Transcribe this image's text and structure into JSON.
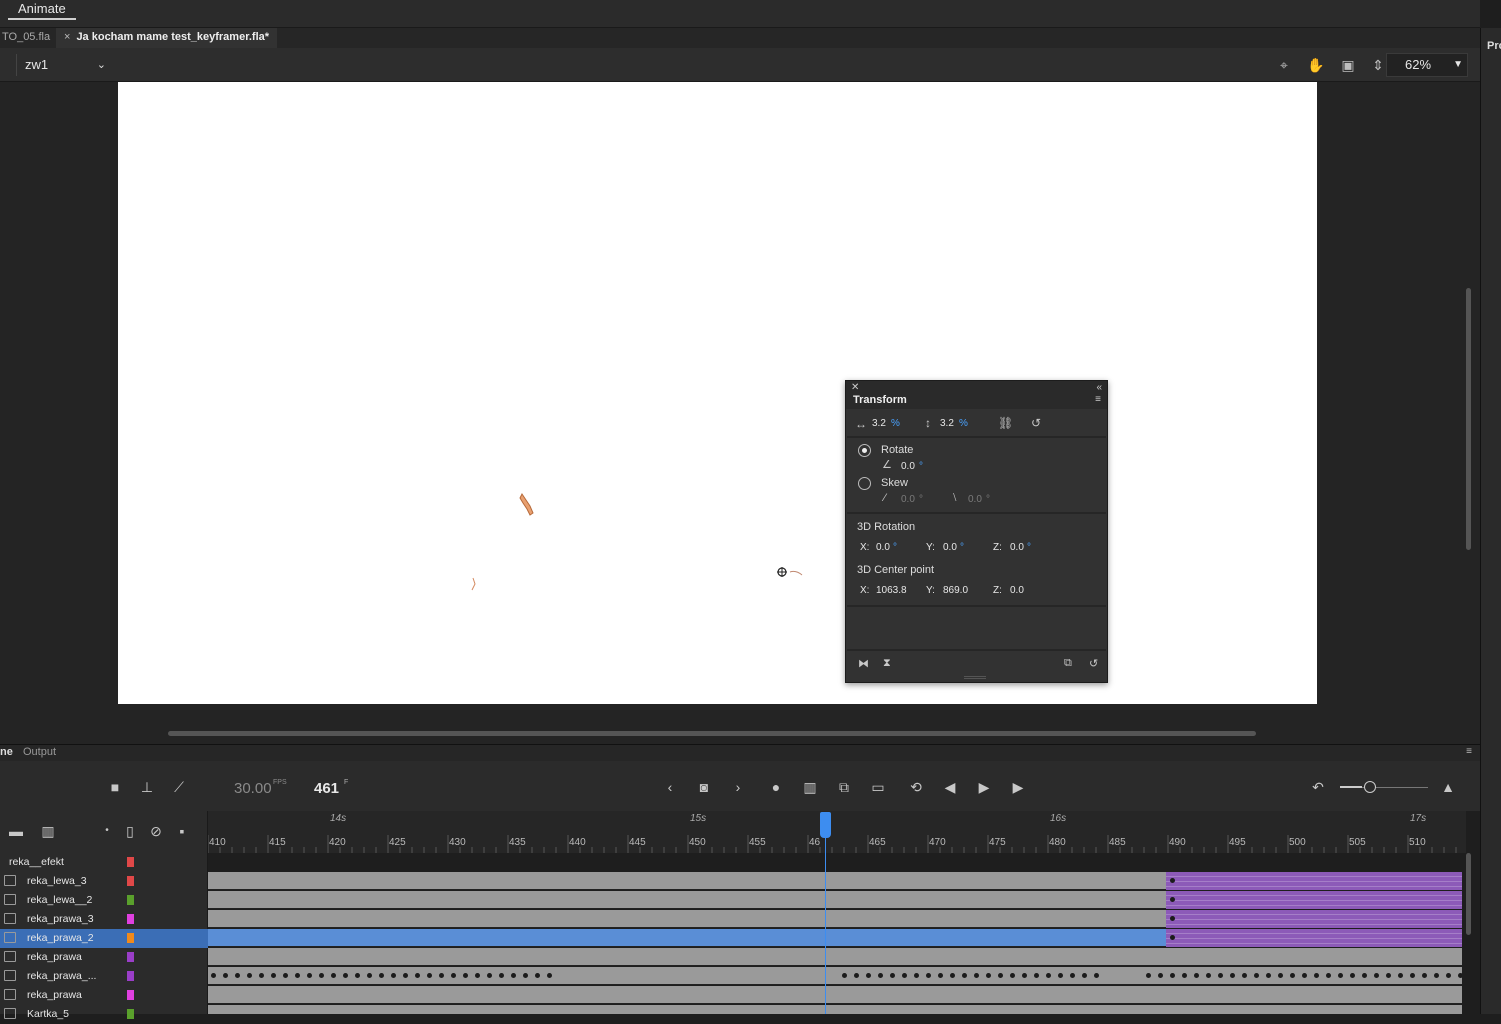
{
  "menu": {
    "animate": "Animate"
  },
  "tabs": [
    {
      "label": "TO_05.fla"
    },
    {
      "label": "Ja kocham mame test_keyframer.fla*",
      "close": "×"
    }
  ],
  "scene": {
    "name": "zw1",
    "zoom": "62%"
  },
  "right_dock": {
    "label": "Pro"
  },
  "transform": {
    "title": "Transform",
    "width_value": "3.2",
    "height_value": "3.2",
    "percent": "%",
    "rotate_label": "Rotate",
    "rotate_value": "0.0",
    "skew_label": "Skew",
    "skew_h": "0.0",
    "skew_v": "0.0",
    "degree": "°",
    "rotation3d_label": "3D Rotation",
    "rot_x_label": "X:",
    "rot_x": "0.0",
    "rot_y_label": "Y:",
    "rot_y": "0.0",
    "rot_z_label": "Z:",
    "rot_z": "0.0",
    "center_label": "3D Center point",
    "cp_x_label": "X:",
    "cp_x": "1063.8",
    "cp_y_label": "Y:",
    "cp_y": "869.0",
    "cp_z_label": "Z:",
    "cp_z": "0.0"
  },
  "timeline": {
    "tab_timeline": "ne",
    "tab_output": "Output",
    "fps": "30.00",
    "fps_unit": "FPS",
    "frame": "461",
    "frame_unit": "F",
    "seconds": [
      "14s",
      "15s",
      "16s",
      "17s"
    ],
    "ticks": [
      "410",
      "415",
      "420",
      "425",
      "430",
      "435",
      "440",
      "445",
      "450",
      "455",
      "46",
      "465",
      "470",
      "475",
      "480",
      "485",
      "490",
      "495",
      "500",
      "505",
      "510"
    ],
    "layers": [
      {
        "name": "reka__efekt",
        "color": "#e04848"
      },
      {
        "name": "reka_lewa_3",
        "color": "#e04848"
      },
      {
        "name": "reka_lewa__2",
        "color": "#5aa02c"
      },
      {
        "name": "reka_prawa_3",
        "color": "#e040e0"
      },
      {
        "name": "reka_prawa_2",
        "color": "#f08a1c",
        "selected": true
      },
      {
        "name": "reka_prawa",
        "color": "#9a3ec8"
      },
      {
        "name": "reka_prawa_...",
        "color": "#9a3ec8"
      },
      {
        "name": "reka_prawa",
        "color": "#e040e0"
      },
      {
        "name": "Kartka_5",
        "color": "#5aa02c"
      }
    ]
  },
  "icons": {
    "close": "close-icon",
    "collapse": "collapse-icon",
    "menu": "panel-menu-icon",
    "camera": "camera-icon",
    "layer_parent": "layer-parenting-icon",
    "graph": "graph-icon",
    "new_folder": "new-folder-icon",
    "delete": "delete-icon",
    "show_all": "show-hide-icon",
    "lock": "lock-icon"
  }
}
